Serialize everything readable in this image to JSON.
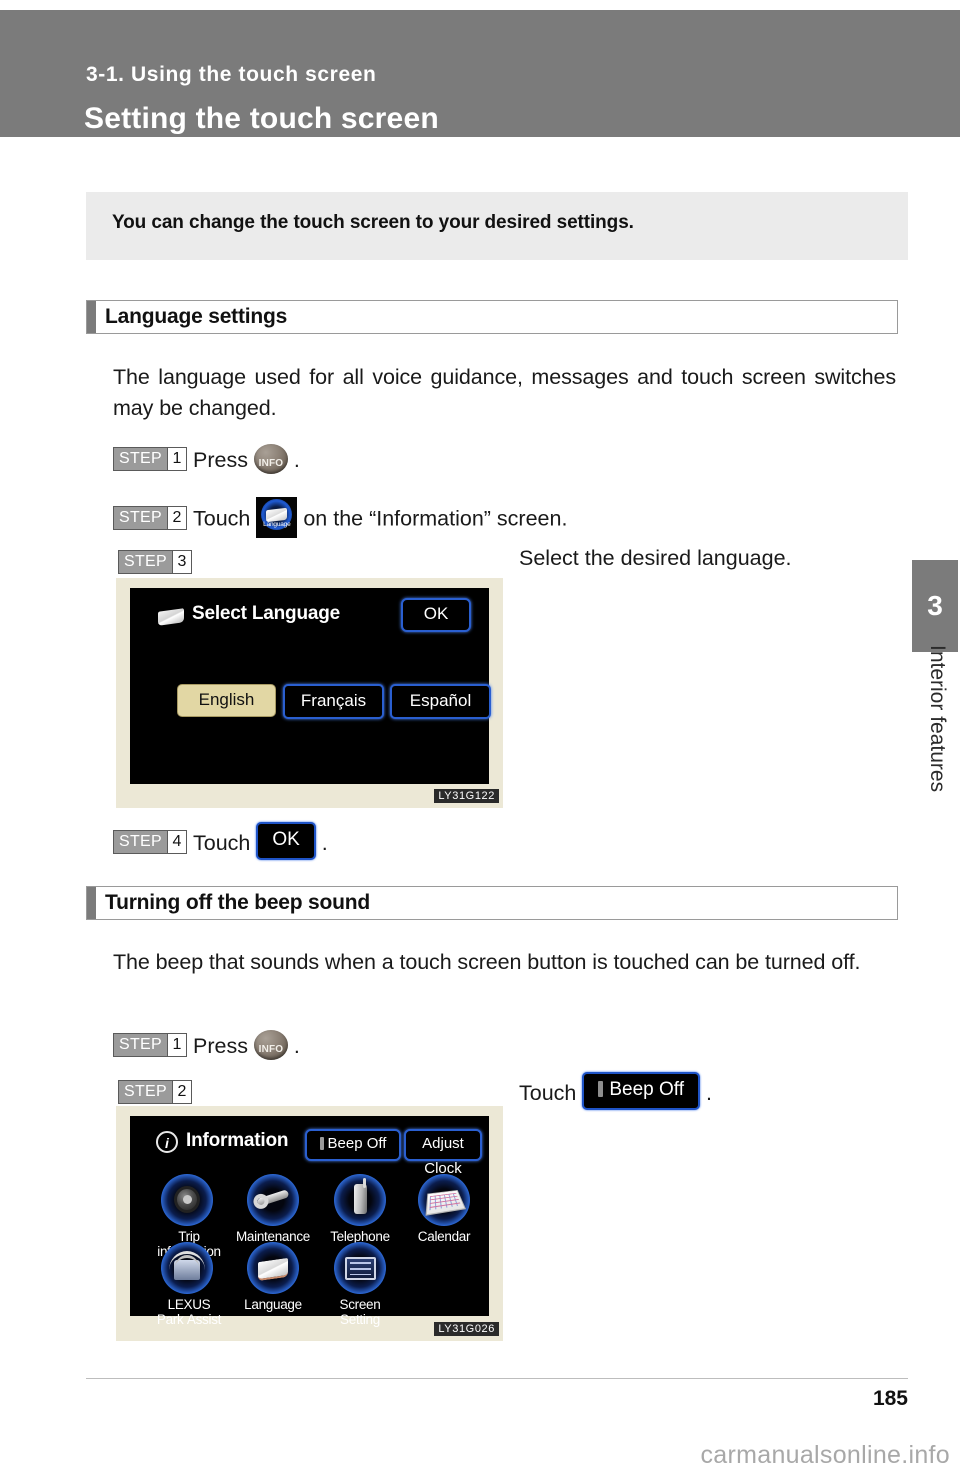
{
  "header": {
    "chapter": "3-1. Using the touch screen",
    "title": "Setting the touch screen"
  },
  "side_tab": {
    "number": "3",
    "label": "Interior features"
  },
  "intro": {
    "text": "You can change the touch screen to your desired settings."
  },
  "sections": [
    {
      "heading": "Language settings",
      "paragraph": "The language used for all voice guidance, messages and touch screen switches may be changed.",
      "steps": [
        {
          "badge_word": "STEP",
          "number": "1",
          "pre": "Press",
          "post": "."
        },
        {
          "badge_word": "STEP",
          "number": "2",
          "pre": "Touch",
          "post": "on the “Information” screen."
        },
        {
          "badge_word": "STEP",
          "number": "3",
          "text": "Select the desired language."
        },
        {
          "badge_word": "STEP",
          "number": "4",
          "pre": "Touch",
          "button": "OK",
          "post": "."
        }
      ]
    },
    {
      "heading": "Turning off the beep sound",
      "paragraph": "The beep that sounds when a touch screen button is touched can be turned off.",
      "steps": [
        {
          "badge_word": "STEP",
          "number": "1",
          "pre": "Press",
          "post": "."
        },
        {
          "badge_word": "STEP",
          "number": "2",
          "pre": "Touch",
          "button": "Beep Off",
          "post": "."
        }
      ]
    }
  ],
  "info_button": {
    "label": "INFO"
  },
  "language_touch_icon": {
    "caption": "Language"
  },
  "figure_select_language": {
    "code": "LY31G122",
    "title": "Select Language",
    "ok_label": "OK",
    "options": [
      {
        "label": "English",
        "selected": true
      },
      {
        "label": "Français",
        "selected": false
      },
      {
        "label": "Español",
        "selected": false
      }
    ]
  },
  "figure_information": {
    "code": "LY31G026",
    "title": "Information",
    "info_glyph": "i",
    "top_buttons": [
      {
        "label": "Beep Off",
        "has_indicator": true
      },
      {
        "label": "Adjust Clock",
        "has_indicator": false
      }
    ],
    "grid": [
      {
        "label": "Trip\ninformation",
        "icon": "tire-icon"
      },
      {
        "label": "Maintenance",
        "icon": "wrench-icon"
      },
      {
        "label": "Telephone",
        "icon": "phone-icon"
      },
      {
        "label": "Calendar",
        "icon": "calendar-icon"
      },
      {
        "label": "LEXUS\nPark Assist",
        "icon": "park-assist-icon"
      },
      {
        "label": "Language",
        "icon": "book-icon"
      },
      {
        "label": "Screen\nSetting",
        "icon": "screen-setting-icon"
      }
    ]
  },
  "footer": {
    "page_number": "185",
    "watermark": "carmanualsonline.info"
  },
  "colors": {
    "header_gray": "#7b7b7b",
    "intro_gray": "#ebebeb",
    "screen_frame": "#ece8d6",
    "screen_black": "#000000",
    "touch_blue": "#2a5fd0",
    "selected_khaki": "#e2d7a4"
  }
}
